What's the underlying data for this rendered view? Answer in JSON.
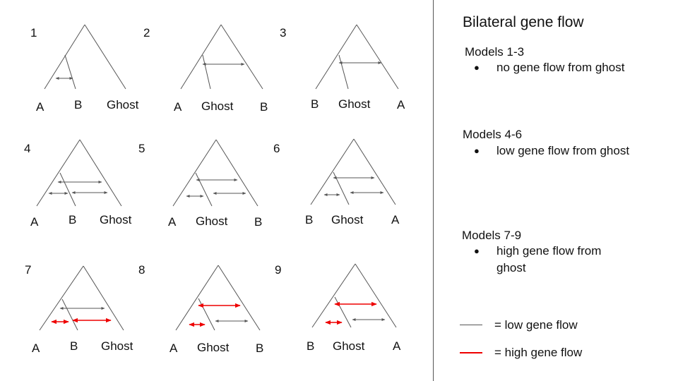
{
  "panel": {
    "title": "Bilateral gene flow",
    "groups": [
      {
        "heading": "Models 1-3",
        "bullet": "no gene flow from ghost"
      },
      {
        "heading": "Models 4-6",
        "bullet": "low gene flow from ghost"
      },
      {
        "heading": "Models 7-9",
        "bullet": "high gene flow from ghost"
      }
    ],
    "legend": [
      {
        "label": "= low gene flow",
        "color": "#555555"
      },
      {
        "label": "= high gene flow",
        "color": "#ee0000"
      }
    ]
  },
  "colors": {
    "low_flow": "#555555",
    "high_flow": "#ee0000",
    "branch": "#555555"
  },
  "models": [
    {
      "number": "1",
      "tips": [
        "A",
        "B",
        "Ghost"
      ],
      "flows": [
        {
          "between": "A-B",
          "level": "low"
        }
      ]
    },
    {
      "number": "2",
      "tips": [
        "A",
        "Ghost",
        "B"
      ],
      "flows": [
        {
          "between": "A/Ghost-B",
          "level": "low"
        }
      ]
    },
    {
      "number": "3",
      "tips": [
        "B",
        "Ghost",
        "A"
      ],
      "flows": [
        {
          "between": "B/Ghost-A",
          "level": "low"
        }
      ]
    },
    {
      "number": "4",
      "tips": [
        "A",
        "B",
        "Ghost"
      ],
      "flows": [
        {
          "between": "A-B",
          "level": "low"
        },
        {
          "between": "B-Ghost",
          "level": "low"
        },
        {
          "between": "A/B-Ghost",
          "level": "low"
        }
      ]
    },
    {
      "number": "5",
      "tips": [
        "A",
        "Ghost",
        "B"
      ],
      "flows": [
        {
          "between": "A-Ghost",
          "level": "low"
        },
        {
          "between": "Ghost-B",
          "level": "low"
        },
        {
          "between": "A/Ghost-B",
          "level": "low"
        }
      ]
    },
    {
      "number": "6",
      "tips": [
        "B",
        "Ghost",
        "A"
      ],
      "flows": [
        {
          "between": "B-Ghost",
          "level": "low"
        },
        {
          "between": "Ghost-A",
          "level": "low"
        },
        {
          "between": "B/Ghost-A",
          "level": "low"
        }
      ]
    },
    {
      "number": "7",
      "tips": [
        "A",
        "B",
        "Ghost"
      ],
      "flows": [
        {
          "between": "A-B",
          "level": "low"
        },
        {
          "between": "B-Ghost",
          "level": "high"
        },
        {
          "between": "A/B-Ghost",
          "level": "high"
        }
      ]
    },
    {
      "number": "8",
      "tips": [
        "A",
        "Ghost",
        "B"
      ],
      "flows": [
        {
          "between": "A-Ghost",
          "level": "high"
        },
        {
          "between": "Ghost-B",
          "level": "high"
        },
        {
          "between": "A/Ghost-B",
          "level": "low"
        }
      ]
    },
    {
      "number": "9",
      "tips": [
        "B",
        "Ghost",
        "A"
      ],
      "flows": [
        {
          "between": "B-Ghost",
          "level": "high"
        },
        {
          "between": "Ghost-A",
          "level": "high"
        },
        {
          "between": "B/Ghost-A",
          "level": "low"
        }
      ]
    }
  ]
}
